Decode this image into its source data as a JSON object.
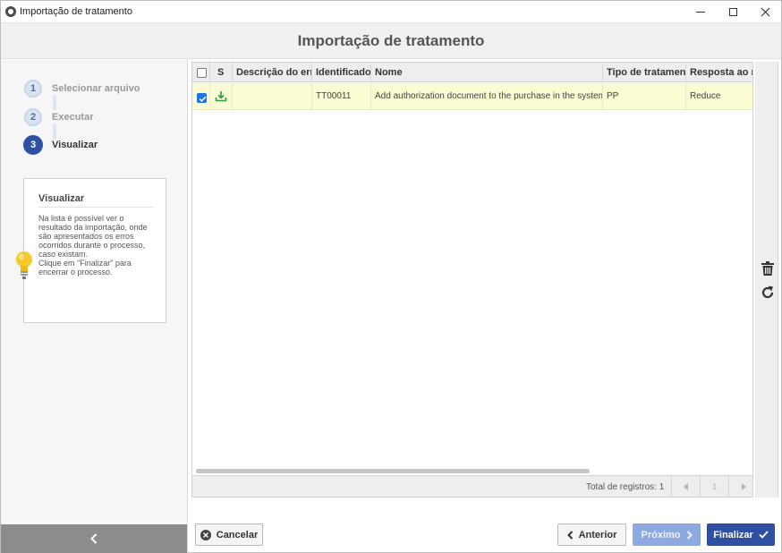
{
  "window": {
    "title": "Importação de tratamento"
  },
  "header": {
    "title": "Importação de tratamento"
  },
  "wizard": {
    "steps": [
      {
        "number": "1",
        "label": "Selecionar arquivo"
      },
      {
        "number": "2",
        "label": "Executar"
      },
      {
        "number": "3",
        "label": "Visualizar"
      }
    ],
    "active_step": 3
  },
  "help": {
    "title": "Visualizar",
    "text": "Na lista é possível ver o\nresultado da importação, onde\nsão apresentados os erros\nocorridos durante o processo,\ncaso existam.\nClique em \"Finalizar\" para\nencerrar o processo."
  },
  "table": {
    "columns": [
      "S",
      "Descrição do erro",
      "Identificador",
      "Nome",
      "Tipo de tratamento",
      "Resposta ao risco"
    ],
    "rows": [
      {
        "checked": true,
        "status_icon": "download-icon",
        "error": "",
        "identifier": "TT00011",
        "name": "Add authorization document to the purchase in the system",
        "type": "PP",
        "response": "Reduce"
      }
    ],
    "footer": {
      "total": "Total de registros: 1",
      "page": "1"
    }
  },
  "buttons": {
    "cancel": "Cancelar",
    "previous": "Anterior",
    "next": "Próximo",
    "finish": "Finalizar"
  },
  "colors": {
    "primary": "#2f4fa2",
    "disabled_primary": "#8ea9e0",
    "row_highlight": "#fbfbd4",
    "checkbox": "#1a73e8",
    "status_icon": "#2e9e3e"
  }
}
